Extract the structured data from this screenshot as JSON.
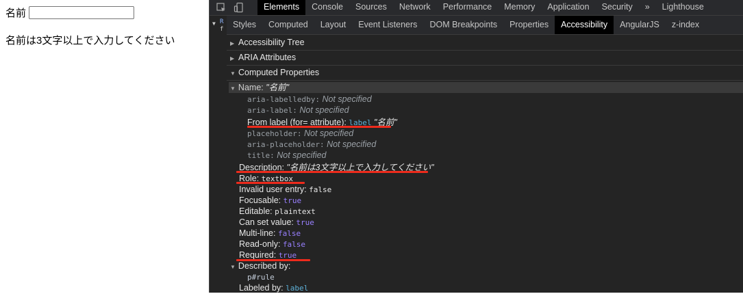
{
  "page": {
    "name_label": "名前",
    "name_value": "",
    "rule_text": "名前は3文字以上で入力してください"
  },
  "devtools": {
    "main_tabs": [
      "Elements",
      "Console",
      "Sources",
      "Network",
      "Performance",
      "Memory",
      "Application",
      "Security",
      "»",
      "Lighthouse"
    ],
    "sub_tabs": [
      "Styles",
      "Computed",
      "Layout",
      "Event Listeners",
      "DOM Breakpoints",
      "Properties",
      "Accessibility",
      "AngularJS",
      "z-index"
    ],
    "dom_stub": [
      "R",
      "f"
    ],
    "sections": {
      "tree": "Accessibility Tree",
      "aria": "ARIA Attributes",
      "computed": "Computed Properties"
    },
    "name_head": {
      "key": "Name:",
      "value": "\"名前\""
    },
    "name_sources": [
      {
        "key": "aria-labelledby:",
        "value": "Not specified"
      },
      {
        "key": "aria-label:",
        "value": "Not specified"
      },
      {
        "key": "From label (for= attribute):",
        "tag": "label",
        "value": "\"名前\""
      },
      {
        "key": "placeholder:",
        "value": "Not specified"
      },
      {
        "key": "aria-placeholder:",
        "value": "Not specified"
      },
      {
        "key": "title:",
        "value": "Not specified"
      }
    ],
    "props": [
      {
        "key": "Description:",
        "value": "\"名前は3文字以上で入力してください\""
      },
      {
        "key": "Role:",
        "value": "textbox"
      },
      {
        "key": "Invalid user entry:",
        "value": "false"
      },
      {
        "key": "Focusable:",
        "value": "true"
      },
      {
        "key": "Editable:",
        "value": "plaintext"
      },
      {
        "key": "Can set value:",
        "value": "true"
      },
      {
        "key": "Multi-line:",
        "value": "false"
      },
      {
        "key": "Read-only:",
        "value": "false"
      },
      {
        "key": "Required:",
        "value": "true"
      }
    ],
    "described_by": {
      "key": "Described by:",
      "value": "p#rule"
    },
    "labeled_by": {
      "key": "Labeled by:",
      "value": "label"
    },
    "annotation_color": "#ee2b1c"
  }
}
